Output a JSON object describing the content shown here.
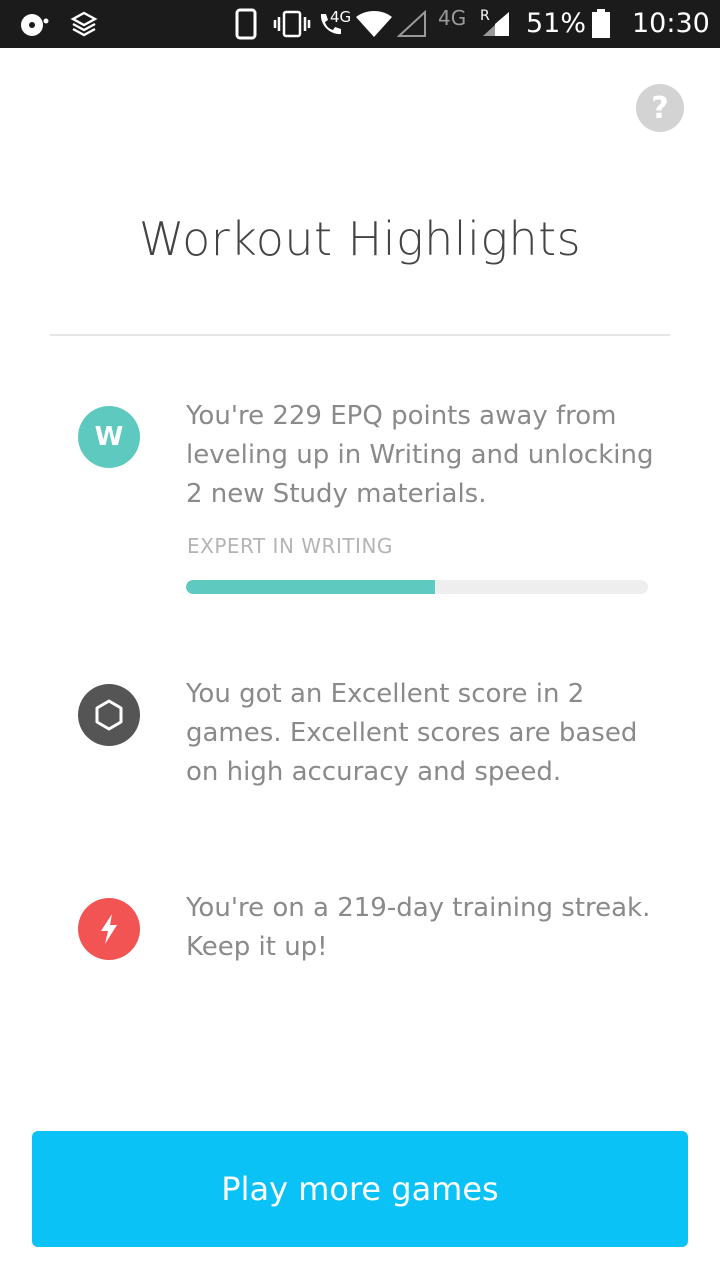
{
  "status_bar": {
    "network_small_1": "4G",
    "network_small_2": "4G",
    "roaming": "R",
    "battery": "51%",
    "time": "10:30"
  },
  "help_label": "?",
  "title": "Workout Highlights",
  "highlights": [
    {
      "badge_letter": "W",
      "badge_color": "#5ec9be",
      "text": "You're 229 EPQ points away from leveling up in Writing and unlocking 2 new Study materials.",
      "label": "EXPERT IN WRITING",
      "progress": 0.54
    },
    {
      "badge_icon": "hexagon-icon",
      "badge_color": "#555555",
      "text": "You got an Excellent score in 2 games. Excellent scores are based on high accuracy and speed."
    },
    {
      "badge_icon": "lightning-icon",
      "badge_color": "#f25353",
      "text": "You're on a 219-day training streak. Keep it up!"
    }
  ],
  "cta_label": "Play more games",
  "colors": {
    "accent": "#0ac2f5",
    "writing": "#5ec9be",
    "streak": "#f25353"
  }
}
